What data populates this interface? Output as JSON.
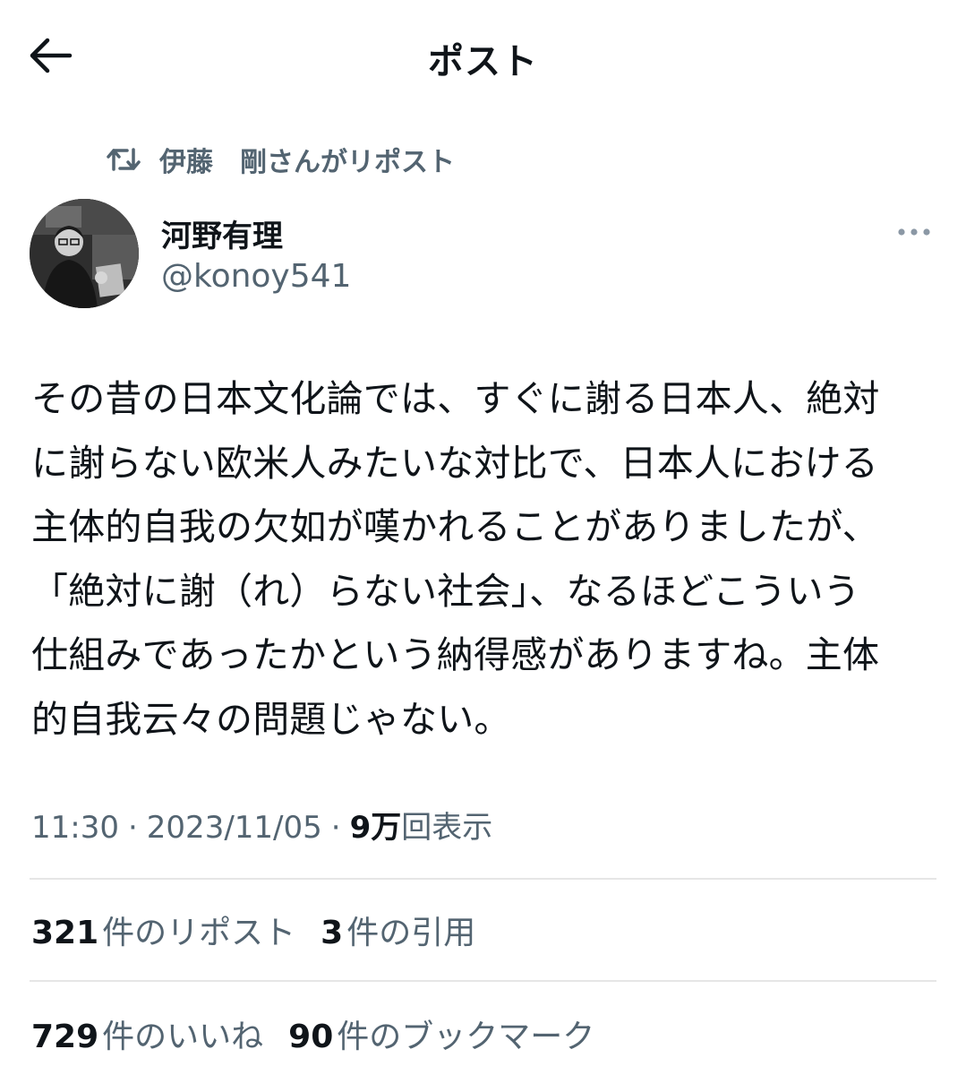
{
  "header": {
    "title": "ポスト",
    "back_icon": "arrow-left-icon"
  },
  "repost_banner": {
    "icon": "repost-icon",
    "text": "伊藤　剛さんがリポスト"
  },
  "author": {
    "name": "河野有理",
    "handle": "@konoy541"
  },
  "post": {
    "text": "その昔の日本文化論では、すぐに謝る日本人、絶対\nに謝らない欧米人みたいな対比で、日本人における\n主体的自我の欠如が嘆かれることがありましたが、\n「絶対に謝（れ）らない社会」、なるほどこういう\n仕組みであったかという納得感がありますね。主体\n的自我云々の問題じゃない。",
    "time": "11:30",
    "date": "2023/11/05",
    "separator": "·",
    "views_count": "9万",
    "views_label": "回表示"
  },
  "stats": {
    "reposts_count": "321",
    "reposts_label": "件のリポスト",
    "quotes_count": "3",
    "quotes_label": "件の引用",
    "likes_count": "729",
    "likes_label": "件のいいね",
    "bookmarks_count": "90",
    "bookmarks_label": "件のブックマーク"
  },
  "colors": {
    "text_primary": "#0f1419",
    "text_secondary": "#536471",
    "divider": "#e6e6e6"
  }
}
